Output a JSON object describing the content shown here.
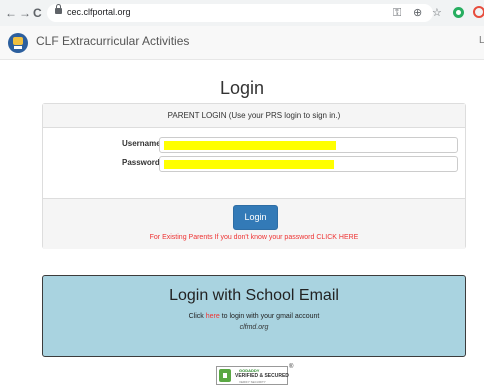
{
  "browser": {
    "back_glyph": "←",
    "forward_glyph": "→",
    "reload_glyph": "C",
    "url": "cec.clfportal.org",
    "key_glyph": "⚿",
    "zoom_glyph": "⊕",
    "star_glyph": "☆"
  },
  "navbar": {
    "brand": "CLF Extracurricular Activities",
    "right_text": "L"
  },
  "page": {
    "title": "Login"
  },
  "panel": {
    "heading": "PARENT LOGIN (Use your PRS login to sign in.)",
    "username_label": "Username",
    "password_label": "Password",
    "login_button": "Login",
    "forgot_text": "For Existing Parents If you don't know your password CLICK HERE"
  },
  "school_email": {
    "title": "Login with School Email",
    "line_prefix": "Click ",
    "link_text": "here",
    "line_suffix": " to login with your gmail account",
    "domain": "clfmd.org"
  },
  "badge": {
    "brand": "GODADDY",
    "main": "VERIFIED & SECURED",
    "sub": "VERIFY SECURITY",
    "reg": "®"
  },
  "colors": {
    "primary_button": "#337ab7",
    "link_red": "#ee3333",
    "school_box": "#a9d3e0",
    "redaction": "#ffff00"
  }
}
